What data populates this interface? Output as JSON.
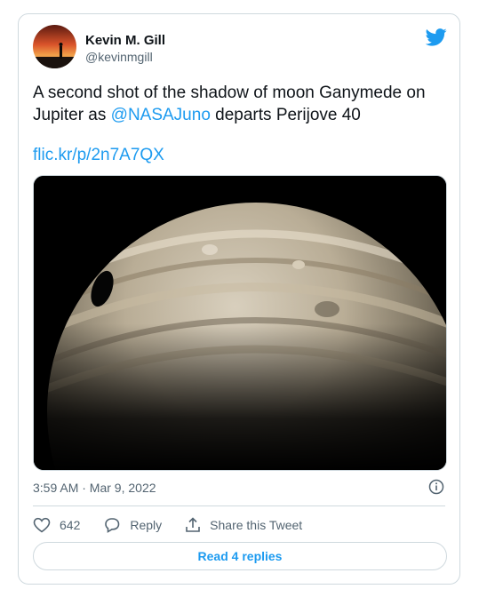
{
  "tweet": {
    "author_name": "Kevin M. Gill",
    "author_handle": "@kevinmgill",
    "text_before": "A second shot of the shadow of moon Ganymede on Jupiter as ",
    "mention": "@NASAJuno",
    "text_after": " departs Perijove 40",
    "link": "flic.kr/p/2n7A7QX",
    "timestamp": "3:59 AM · Mar 9, 2022",
    "like_count": "642",
    "reply_label": "Reply",
    "share_label": "Share this Tweet",
    "read_replies_label": "Read 4 replies"
  },
  "colors": {
    "accent": "#1d9bf0",
    "muted": "#536471",
    "border": "#cfd9de"
  },
  "icons": [
    "twitter-bird-icon",
    "info-icon",
    "heart-icon",
    "reply-bubble-icon",
    "share-icon"
  ]
}
